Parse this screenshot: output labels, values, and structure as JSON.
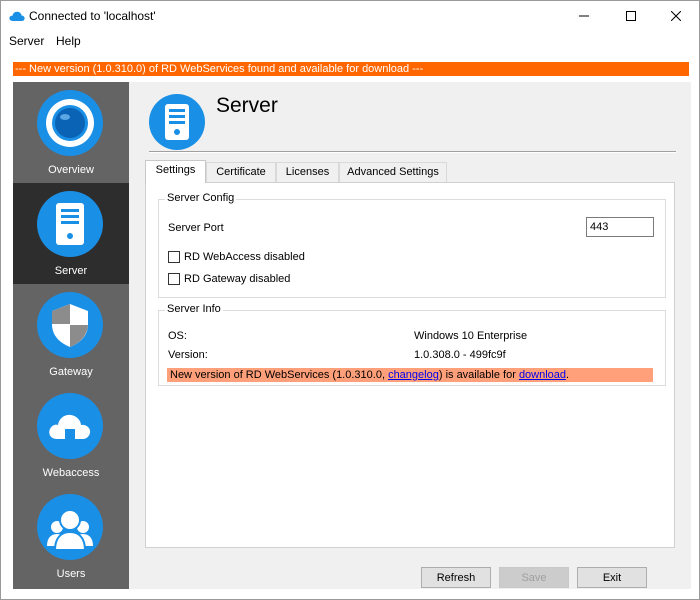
{
  "window": {
    "title": "Connected to 'localhost'"
  },
  "menu": [
    "Server",
    "Help"
  ],
  "update_banner": "--- New version (1.0.310.0) of RD WebServices found and available for download ---",
  "sidebar": {
    "items": [
      {
        "label": "Overview",
        "icon": "overview-icon",
        "active": false
      },
      {
        "label": "Server",
        "icon": "server-icon",
        "active": true
      },
      {
        "label": "Gateway",
        "icon": "shield-icon",
        "active": false
      },
      {
        "label": "Webaccess",
        "icon": "cloud-icon",
        "active": false
      },
      {
        "label": "Users",
        "icon": "users-icon",
        "active": false
      }
    ]
  },
  "page": {
    "title": "Server",
    "icon": "server-icon"
  },
  "tabs": [
    {
      "label": "Settings",
      "active": true
    },
    {
      "label": "Certificate",
      "active": false
    },
    {
      "label": "Licenses",
      "active": false
    },
    {
      "label": "Advanced Settings",
      "active": false
    }
  ],
  "server_config": {
    "title": "Server Config",
    "port_label": "Server Port",
    "port_value": "443",
    "webaccess_disabled_label": "RD WebAccess disabled",
    "webaccess_disabled_checked": false,
    "gateway_disabled_label": "RD Gateway disabled",
    "gateway_disabled_checked": false
  },
  "server_info": {
    "title": "Server Info",
    "os_label": "OS:",
    "os_value": "Windows 10 Enterprise",
    "version_label": "Version:",
    "version_value": "1.0.308.0 - 499fc9f",
    "notice_prefix": "New version of RD WebServices (1.0.310.0, ",
    "notice_changelog": "changelog",
    "notice_middle": ") is available for ",
    "notice_download": "download",
    "notice_suffix": "."
  },
  "buttons": {
    "refresh": "Refresh",
    "save": "Save",
    "exit": "Exit"
  },
  "colors": {
    "accent": "#1a8fe6",
    "banner": "#ff6600",
    "notice": "#ffa07a",
    "sidebar": "#646464",
    "sidebar_active": "#2d2d2d"
  }
}
